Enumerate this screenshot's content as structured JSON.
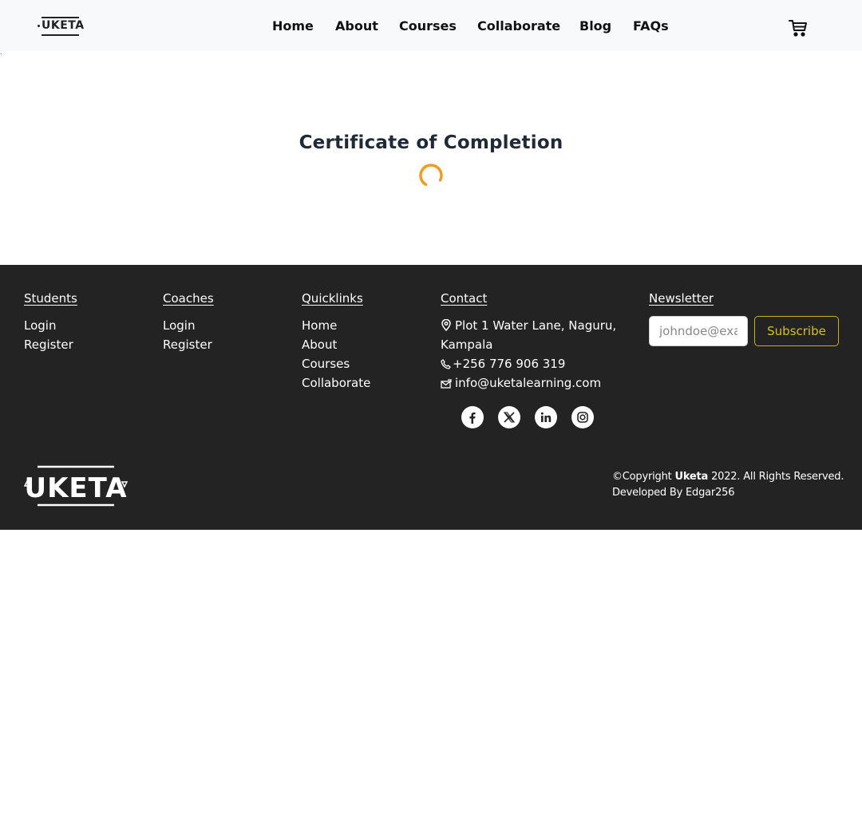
{
  "header": {
    "logo_text": "UKETA",
    "nav": [
      "Home",
      "About",
      "Courses",
      "Collaborate",
      "Blog",
      "FAQs"
    ],
    "cart_icon": "cart-icon"
  },
  "main": {
    "title": "Certificate of Completion",
    "loading_icon": "spinner-icon",
    "accent_color": "#f39a25"
  },
  "footer": {
    "students": {
      "title": "Students",
      "links": [
        "Login",
        "Register"
      ]
    },
    "coaches": {
      "title": "Coaches",
      "links": [
        "Login",
        "Register"
      ]
    },
    "quicklinks": {
      "title": "Quicklinks",
      "links": [
        "Home",
        "About",
        "Courses",
        "Collaborate"
      ]
    },
    "contact": {
      "title": "Contact",
      "address_line1": "Plot 1 Water Lane, Naguru,",
      "address_line2": "Kampala",
      "phone": "+256 776 906 319",
      "email": "info@uketalearning.com"
    },
    "social_icons": [
      "facebook-icon",
      "x-icon",
      "linkedin-icon",
      "instagram-icon"
    ],
    "newsletter": {
      "title": "Newsletter",
      "placeholder": "johndoe@example.com",
      "button": "Subscribe",
      "button_color": "#d4c21b"
    },
    "logo_text": "UKETA",
    "copyright_prefix": "©Copyright",
    "copyright_brand": "Uketa",
    "copyright_suffix": "2022. All Rights Reserved.",
    "developer": "Developed By Edgar256",
    "background_color": "#232323"
  }
}
